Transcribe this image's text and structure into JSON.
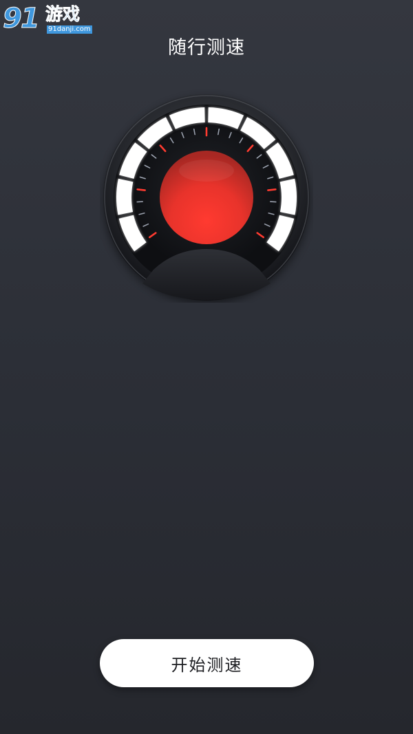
{
  "watermark": {
    "digits": "91",
    "name": "游戏",
    "site": "91danji.com"
  },
  "header": {
    "title": "随行测速"
  },
  "gauge": {
    "icon": "speedometer-gauge",
    "accent_color": "#ff3b30",
    "arc_color": "#ffffff"
  },
  "actions": {
    "start_label": "开始测速"
  }
}
